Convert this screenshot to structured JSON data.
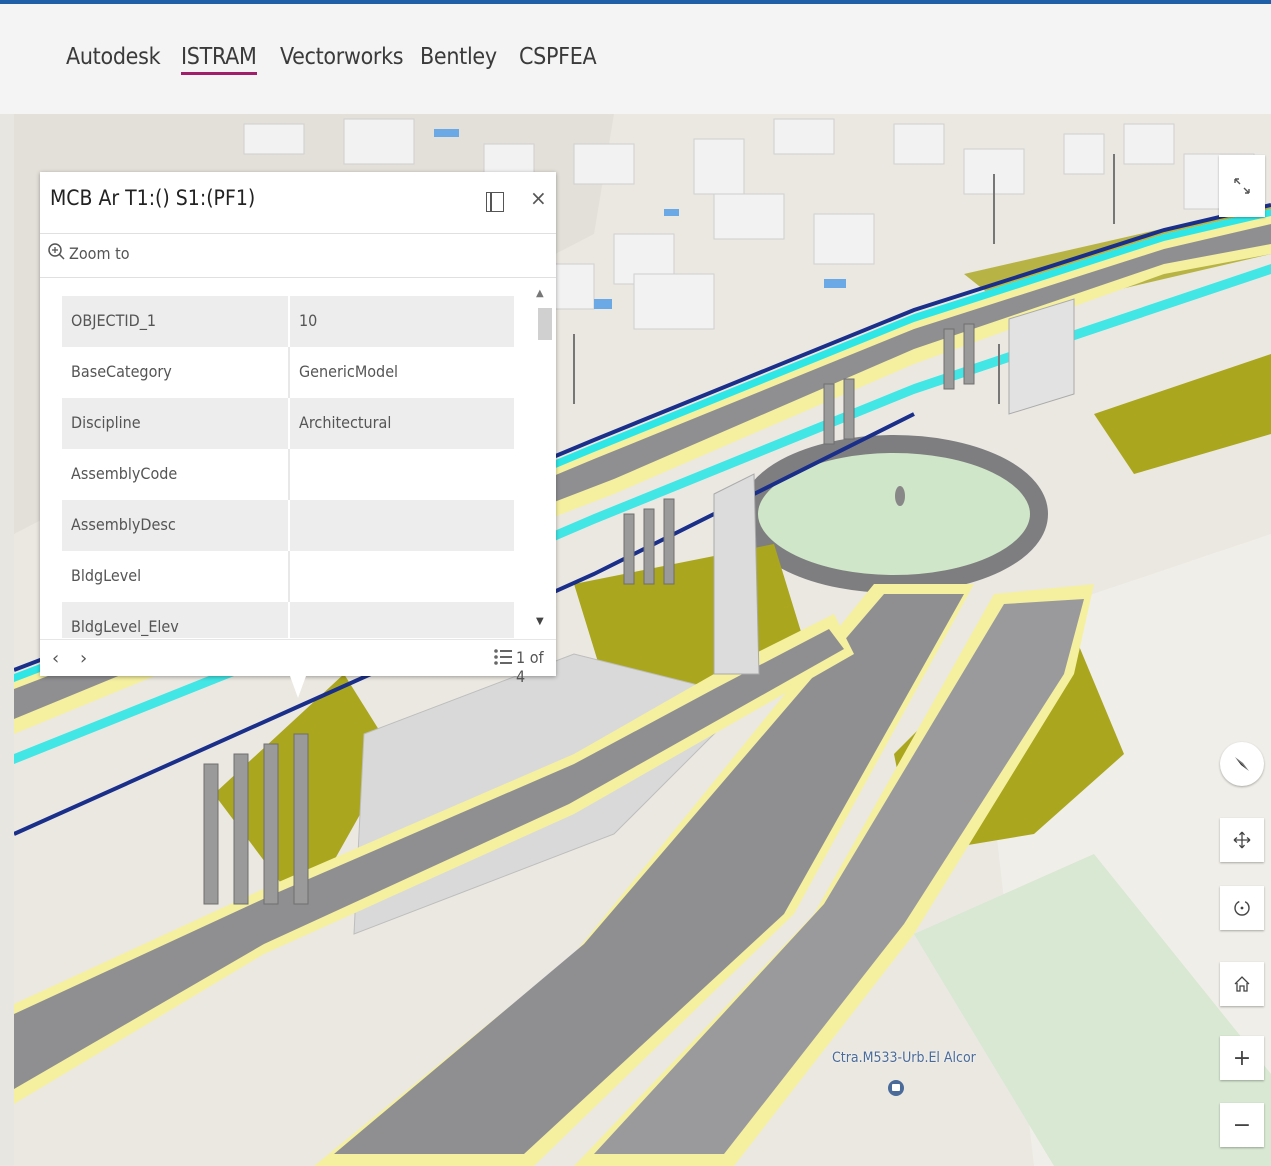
{
  "tabs": [
    {
      "label": "Autodesk",
      "active": false
    },
    {
      "label": "ISTRAM",
      "active": true
    },
    {
      "label": "Vectorworks",
      "active": false
    },
    {
      "label": "Bentley",
      "active": false
    },
    {
      "label": "CSPFEA",
      "active": false
    }
  ],
  "popup": {
    "title": "MCB Ar T1:() S1:(PF1)",
    "zoom_label": "Zoom to",
    "rows": [
      {
        "key": "OBJECTID_1",
        "value": "10"
      },
      {
        "key": "BaseCategory",
        "value": "GenericModel"
      },
      {
        "key": "Discipline",
        "value": "Architectural"
      },
      {
        "key": "AssemblyCode",
        "value": ""
      },
      {
        "key": "AssemblyDesc",
        "value": ""
      },
      {
        "key": "BldgLevel",
        "value": ""
      },
      {
        "key": "BldgLevel_Elev",
        "value": ""
      }
    ],
    "nav_prev": "‹",
    "nav_next": "›",
    "page_count": "1 of 4",
    "close_glyph": "×"
  },
  "map": {
    "label": "Ctra.M533-Urb.El Alcor"
  },
  "controls": {
    "zoom_in": "+",
    "zoom_out": "−"
  },
  "colors": {
    "accent_bar": "#1f5fa8",
    "active_tab_underline": "#a01e6a",
    "road": "#8f8f92",
    "lane_cyan": "#2fe6e6",
    "railing": "#1a2f8a",
    "edge_yellow": "#f5f0a0",
    "embankment": "#aaa61e",
    "grass": "#cfe6c8"
  }
}
